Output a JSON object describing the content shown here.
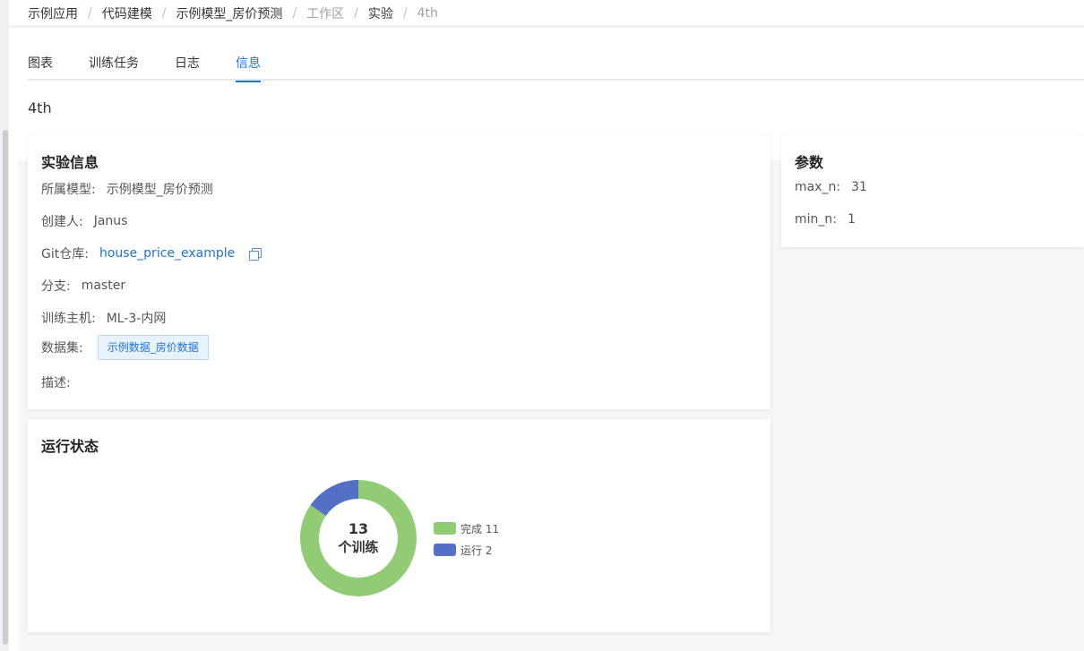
{
  "breadcrumb": [
    "示例应用",
    "代码建模",
    "示例模型_房价预测",
    "工作区",
    "实验",
    "4th"
  ],
  "breadcrumb_sep": "/",
  "tabs": [
    {
      "label": "图表",
      "active": false
    },
    {
      "label": "训练任务",
      "active": false
    },
    {
      "label": "日志",
      "active": false
    },
    {
      "label": "信息",
      "active": true
    }
  ],
  "experiment_title": "4th",
  "info_card": {
    "title": "实验信息",
    "model_label": "所属模型:",
    "model_value": "示例模型_房价预测",
    "creator_label": "创建人:",
    "creator_value": "Janus",
    "git_label": "Git仓库:",
    "git_value": "house_price_example",
    "branch_label": "分支:",
    "branch_value": "master",
    "host_label": "训练主机:",
    "host_value": "ML-3-内网",
    "dataset_label": "数据集:",
    "dataset_value": "示例数据_房价数据",
    "desc_label": "描述:",
    "desc_value": ""
  },
  "param_card": {
    "title": "参数",
    "params": [
      {
        "key": "max_n:",
        "value": "31"
      },
      {
        "key": "min_n:",
        "value": "1"
      }
    ]
  },
  "status_card": {
    "title": "运行状态",
    "center_number": "13",
    "center_label": "个训练"
  },
  "colors": {
    "done": "#91cb74",
    "running": "#5470c6",
    "accent": "#1f73d6"
  },
  "chart_data": {
    "type": "pie",
    "series": [
      {
        "name": "完成 11",
        "value": 11
      },
      {
        "name": "运行 2",
        "value": 2
      }
    ]
  }
}
